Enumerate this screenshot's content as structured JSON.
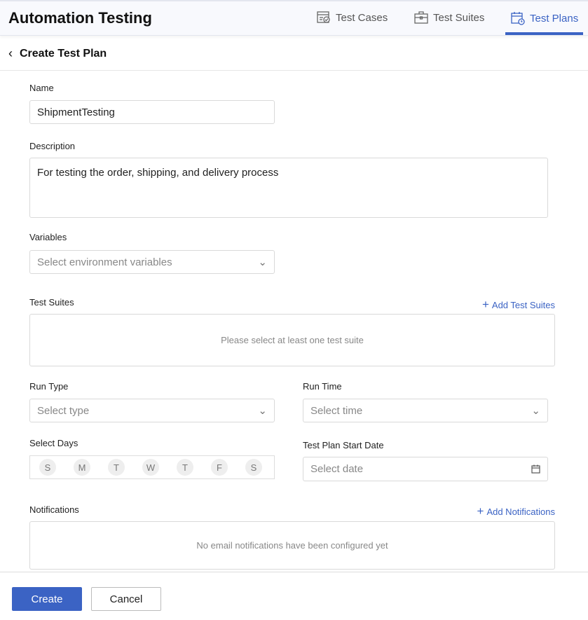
{
  "app": {
    "title": "Automation Testing"
  },
  "tabs": [
    {
      "label": "Test Cases",
      "icon": "test-cases-icon"
    },
    {
      "label": "Test Suites",
      "icon": "briefcase-icon"
    },
    {
      "label": "Test Plans",
      "icon": "calendar-clock-icon",
      "active": true
    }
  ],
  "page": {
    "title": "Create Test Plan"
  },
  "form": {
    "name": {
      "label": "Name",
      "value": "ShipmentTesting"
    },
    "description": {
      "label": "Description",
      "value": "For testing the order, shipping, and delivery process"
    },
    "variables": {
      "label": "Variables",
      "placeholder": "Select environment variables"
    },
    "test_suites": {
      "label": "Test Suites",
      "add": "Add Test Suites",
      "empty": "Please select at least one test suite"
    },
    "run_type": {
      "label": "Run Type",
      "placeholder": "Select type"
    },
    "run_time": {
      "label": "Run Time",
      "placeholder": "Select time"
    },
    "select_days": {
      "label": "Select Days",
      "days": [
        "S",
        "M",
        "T",
        "W",
        "T",
        "F",
        "S"
      ]
    },
    "start_date": {
      "label": "Test Plan Start Date",
      "placeholder": "Select date"
    },
    "notifications": {
      "label": "Notifications",
      "add": "Add Notifications",
      "empty": "No email notifications have been configured yet"
    }
  },
  "footer": {
    "create": "Create",
    "cancel": "Cancel"
  },
  "colors": {
    "accent": "#3b63c4"
  }
}
